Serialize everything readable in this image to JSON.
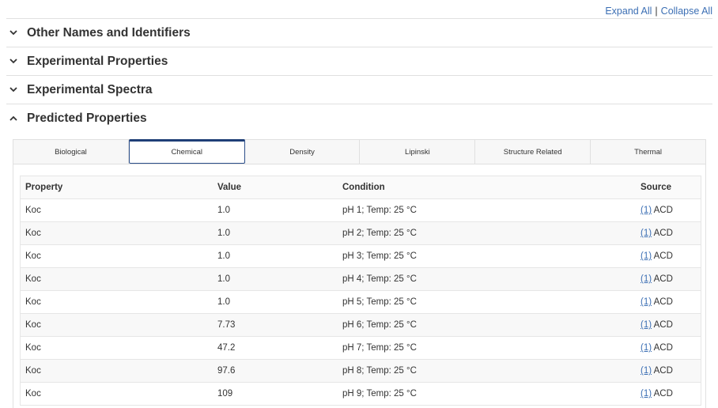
{
  "top_links": {
    "expand_all": "Expand All",
    "separator": "|",
    "collapse_all": "Collapse All"
  },
  "sections": [
    {
      "title": "Other Names and Identifiers",
      "expanded": false,
      "icon": "chevron-down-icon"
    },
    {
      "title": "Experimental Properties",
      "expanded": false,
      "icon": "chevron-down-icon"
    },
    {
      "title": "Experimental Spectra",
      "expanded": false,
      "icon": "chevron-down-icon"
    },
    {
      "title": "Predicted Properties",
      "expanded": true,
      "icon": "chevron-up-icon"
    }
  ],
  "tabs": [
    {
      "label": "Biological",
      "active": false
    },
    {
      "label": "Chemical",
      "active": true
    },
    {
      "label": "Density",
      "active": false
    },
    {
      "label": "Lipinski",
      "active": false
    },
    {
      "label": "Structure Related",
      "active": false
    },
    {
      "label": "Thermal",
      "active": false
    }
  ],
  "table": {
    "headers": {
      "property": "Property",
      "value": "Value",
      "condition": "Condition",
      "source": "Source"
    },
    "rows": [
      {
        "property": "Koc",
        "value": "1.0",
        "condition": "pH 1; Temp: 25 °C",
        "source_link": "(1)",
        "source": "ACD"
      },
      {
        "property": "Koc",
        "value": "1.0",
        "condition": "pH 2; Temp: 25 °C",
        "source_link": "(1)",
        "source": "ACD"
      },
      {
        "property": "Koc",
        "value": "1.0",
        "condition": "pH 3; Temp: 25 °C",
        "source_link": "(1)",
        "source": "ACD"
      },
      {
        "property": "Koc",
        "value": "1.0",
        "condition": "pH 4; Temp: 25 °C",
        "source_link": "(1)",
        "source": "ACD"
      },
      {
        "property": "Koc",
        "value": "1.0",
        "condition": "pH 5; Temp: 25 °C",
        "source_link": "(1)",
        "source": "ACD"
      },
      {
        "property": "Koc",
        "value": "7.73",
        "condition": "pH 6; Temp: 25 °C",
        "source_link": "(1)",
        "source": "ACD"
      },
      {
        "property": "Koc",
        "value": "47.2",
        "condition": "pH 7; Temp: 25 °C",
        "source_link": "(1)",
        "source": "ACD"
      },
      {
        "property": "Koc",
        "value": "97.6",
        "condition": "pH 8; Temp: 25 °C",
        "source_link": "(1)",
        "source": "ACD"
      },
      {
        "property": "Koc",
        "value": "109",
        "condition": "pH 9; Temp: 25 °C",
        "source_link": "(1)",
        "source": "ACD"
      }
    ]
  },
  "colors": {
    "link": "#3c6fb4",
    "active_tab_border": "#1f3f77"
  }
}
